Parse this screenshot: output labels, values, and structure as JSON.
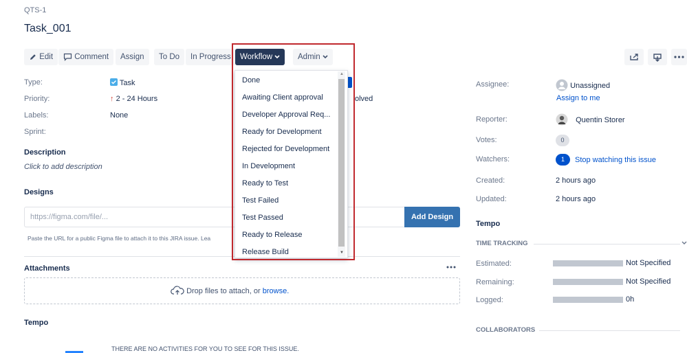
{
  "issue": {
    "key": "QTS-1",
    "title": "Task_001"
  },
  "toolbar": {
    "edit": "Edit",
    "comment": "Comment",
    "assign": "Assign",
    "todo": "To Do",
    "in_progress": "In Progress",
    "workflow": "Workflow",
    "admin": "Admin"
  },
  "details": {
    "type_label": "Type:",
    "type_value": "Task",
    "priority_label": "Priority:",
    "priority_value": "2 - 24 Hours",
    "labels_label": "Labels:",
    "labels_value": "None",
    "sprint_label": "Sprint:",
    "resolution_fragment": "olved"
  },
  "description": {
    "heading": "Description",
    "placeholder": "Click to add description"
  },
  "designs": {
    "heading": "Designs",
    "input_placeholder": "https://figma.com/file/...",
    "add_button": "Add Design",
    "help": "Paste the URL for a public Figma file to attach it to this JIRA issue. Lea"
  },
  "attachments": {
    "heading": "Attachments",
    "drop_text": "Drop files to attach, or",
    "browse": "browse."
  },
  "tempo_left": {
    "heading": "Tempo",
    "empty": "THERE ARE NO ACTIVITIES FOR YOU TO SEE FOR THIS ISSUE."
  },
  "workflow_menu": {
    "items": [
      "Done",
      "Awaiting Client approval",
      "Developer Approval Req...",
      "Ready for Development",
      "Rejected for Development",
      "In Development",
      "Ready to Test",
      "Test Failed",
      "Test Passed",
      "Ready to Release",
      "Release Build"
    ]
  },
  "people": {
    "assignee_label": "Assignee:",
    "assignee_value": "Unassigned",
    "assign_to_me": "Assign to me",
    "reporter_label": "Reporter:",
    "reporter_value": "Quentin Storer",
    "votes_label": "Votes:",
    "votes_count": "0",
    "watchers_label": "Watchers:",
    "watchers_count": "1",
    "watchers_action": "Stop watching this issue"
  },
  "dates": {
    "created_label": "Created:",
    "created_value": "2 hours ago",
    "updated_label": "Updated:",
    "updated_value": "2 hours ago"
  },
  "tempo_right": {
    "heading": "Tempo",
    "time_tracking": "TIME TRACKING",
    "estimated_label": "Estimated:",
    "estimated_value": "Not Specified",
    "remaining_label": "Remaining:",
    "remaining_value": "Not Specified",
    "logged_label": "Logged:",
    "logged_value": "0h",
    "collaborators": "COLLABORATORS"
  },
  "colors": {
    "primary": "#0052cc",
    "workflow_button": "#253858",
    "highlight": "#c0282d",
    "add_design": "#3572b0"
  }
}
